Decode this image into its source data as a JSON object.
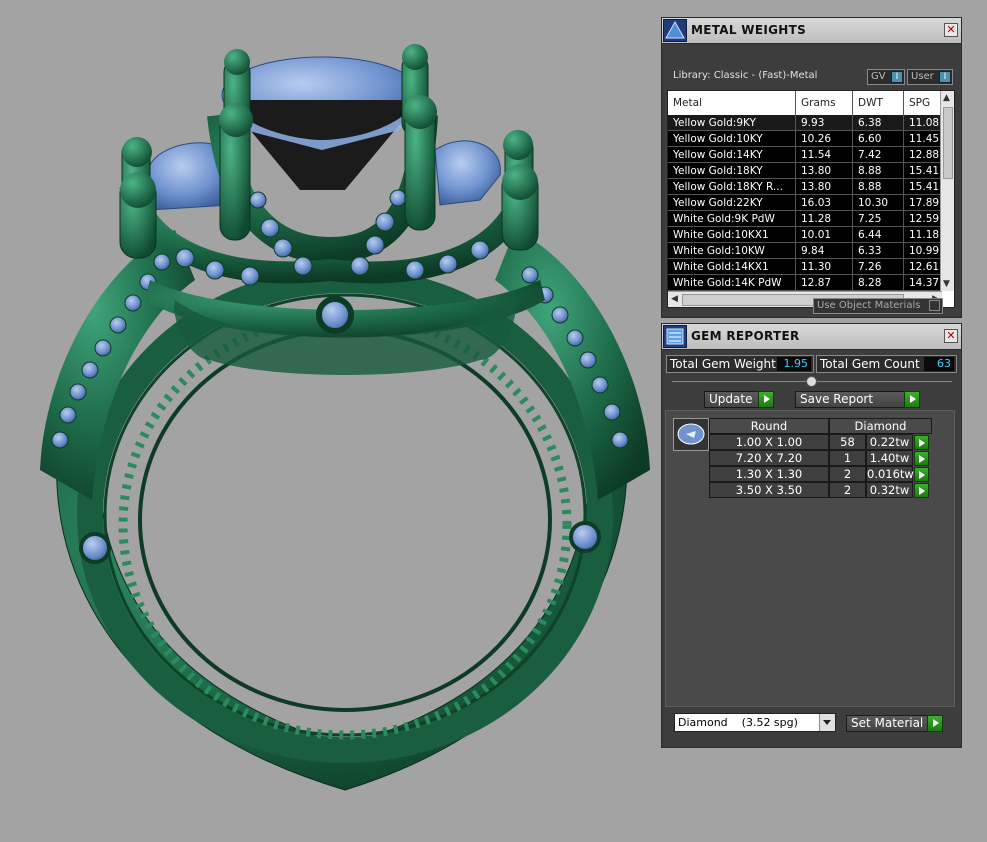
{
  "metal_weights": {
    "title": "METAL WEIGHTS",
    "library": "Library: Classic - (Fast)-Metal",
    "gv_label": "GV",
    "user_label": "User",
    "columns": [
      "Metal",
      "Grams",
      "DWT",
      "SPG"
    ],
    "rows": [
      [
        "Yellow Gold:9KY",
        "9.93",
        "6.38",
        "11.08"
      ],
      [
        "Yellow Gold:10KY",
        "10.26",
        "6.60",
        "11.45"
      ],
      [
        "Yellow Gold:14KY",
        "11.54",
        "7.42",
        "12.88"
      ],
      [
        "Yellow Gold:18KY",
        "13.80",
        "8.88",
        "15.41"
      ],
      [
        "Yellow Gold:18KY R...",
        "13.80",
        "8.88",
        "15.41"
      ],
      [
        "Yellow Gold:22KY",
        "16.03",
        "10.30",
        "17.89"
      ],
      [
        "White Gold:9K PdW",
        "11.28",
        "7.25",
        "12.59"
      ],
      [
        "White Gold:10KX1",
        "10.01",
        "6.44",
        "11.18"
      ],
      [
        "White Gold:10KW",
        "9.84",
        "6.33",
        "10.99"
      ],
      [
        "White Gold:14KX1",
        "11.30",
        "7.26",
        "12.61"
      ],
      [
        "White Gold:14K PdW",
        "12.87",
        "8.28",
        "14.37"
      ]
    ],
    "use_object_materials": "Use Object Materials"
  },
  "gem_reporter": {
    "title": "GEM REPORTER",
    "total_weight_label": "Total Gem Weight",
    "total_weight": "1.95",
    "total_count_label": "Total Gem Count",
    "total_count": "63",
    "update_label": "Update",
    "save_report_label": "Save Report",
    "shape_header": "Round",
    "type_header": "Diamond",
    "rows": [
      [
        "1.00 X 1.00",
        "58",
        "0.22tw"
      ],
      [
        "7.20 X 7.20",
        "1",
        "1.40tw"
      ],
      [
        "1.30 X 1.30",
        "2",
        "0.016tw"
      ],
      [
        "3.50 X 3.50",
        "2",
        "0.32tw"
      ]
    ],
    "material_select": "Diamond    (3.52 spg)",
    "set_material_label": "Set Material"
  },
  "colors": {
    "metal_green": "#1e6b4a",
    "gem_blue": "#6f93cf",
    "viewport_bg": "#a3a3a3",
    "panel_bg": "#3d3d3d"
  }
}
